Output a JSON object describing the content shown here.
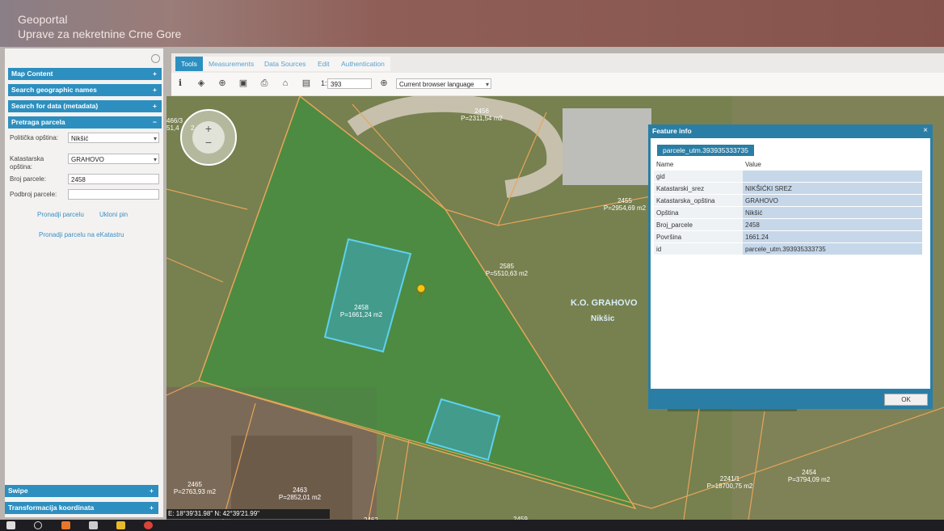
{
  "header": {
    "title_line1": "Geoportal",
    "title_line2": "Uprave za nekretnine Crne Gore"
  },
  "sidebar": {
    "sections": [
      {
        "label": "Map Content",
        "sign": "+"
      },
      {
        "label": "Search geographic names",
        "sign": "+"
      },
      {
        "label": "Search for data (metadata)",
        "sign": "+"
      },
      {
        "label": "Pretraga parcela",
        "sign": "−"
      }
    ],
    "form": {
      "opstina_label": "Politička opština:",
      "opstina_value": "Nikšić",
      "katastarska_label": "Katastarska opština:",
      "katastarska_value": "GRAHOVO",
      "broj_label": "Broj parcele:",
      "broj_value": "2458",
      "podbroj_label": "Podbroj parcele:",
      "podbroj_value": "",
      "find_link": "Pronadji parcelu",
      "remove_pin_link": "Ukloni pin",
      "ekatastar_link": "Pronadji parcelu na eKatastru"
    },
    "bottom_sections": [
      {
        "label": "Swipe",
        "sign": "+"
      },
      {
        "label": "Transformacija koordinata",
        "sign": "+"
      }
    ]
  },
  "tabs": [
    "Tools",
    "Measurements",
    "Data Sources",
    "Edit",
    "Authentication"
  ],
  "toolbar": {
    "scale_prefix": "1:",
    "scale_value": "393",
    "language": "Current browser language"
  },
  "map": {
    "parcels": [
      {
        "number": "2456",
        "area": "P=2311,54 m2"
      },
      {
        "number": "2455",
        "area": "P=2954,69 m2"
      },
      {
        "number": "2585",
        "area": "P=5510,63 m2"
      },
      {
        "number": "2458",
        "area": "P=1661,24 m2"
      },
      {
        "number": "2465",
        "area": "P=2763,93 m2"
      },
      {
        "number": "2463",
        "area": "P=2852,01 m2"
      },
      {
        "number": "2241/1",
        "area": "P=18700,75 m2"
      },
      {
        "number": "2454",
        "area": "P=3794,09 m2"
      },
      {
        "number": "2462",
        "area": ""
      },
      {
        "number": "2459",
        "area": ""
      }
    ],
    "partial_label_1": "466/3",
    "partial_label_2": "51,4",
    "partial_label_3": "2",
    "ko_label": "K.O. GRAHOVO",
    "municipality_label": "Nikšic",
    "coordinates": "E: 18°39'31.98\"  N: 42°39'21.99\""
  },
  "feature_info": {
    "title": "Feature info",
    "layer_tab": "parcele_utm.393935333735",
    "col_name": "Name",
    "col_value": "Value",
    "rows": [
      {
        "name": "gid",
        "value": ""
      },
      {
        "name": "Katastarski_srez",
        "value": "NIKŠIĆKI SREZ"
      },
      {
        "name": "Katastarska_opština",
        "value": "GRAHOVO"
      },
      {
        "name": "Opština",
        "value": "Nikšić"
      },
      {
        "name": "Broj_parcele",
        "value": "2458"
      },
      {
        "name": "Površina",
        "value": "1661.24"
      },
      {
        "name": "id",
        "value": "parcele_utm.393935333735"
      }
    ],
    "ok_label": "OK"
  }
}
